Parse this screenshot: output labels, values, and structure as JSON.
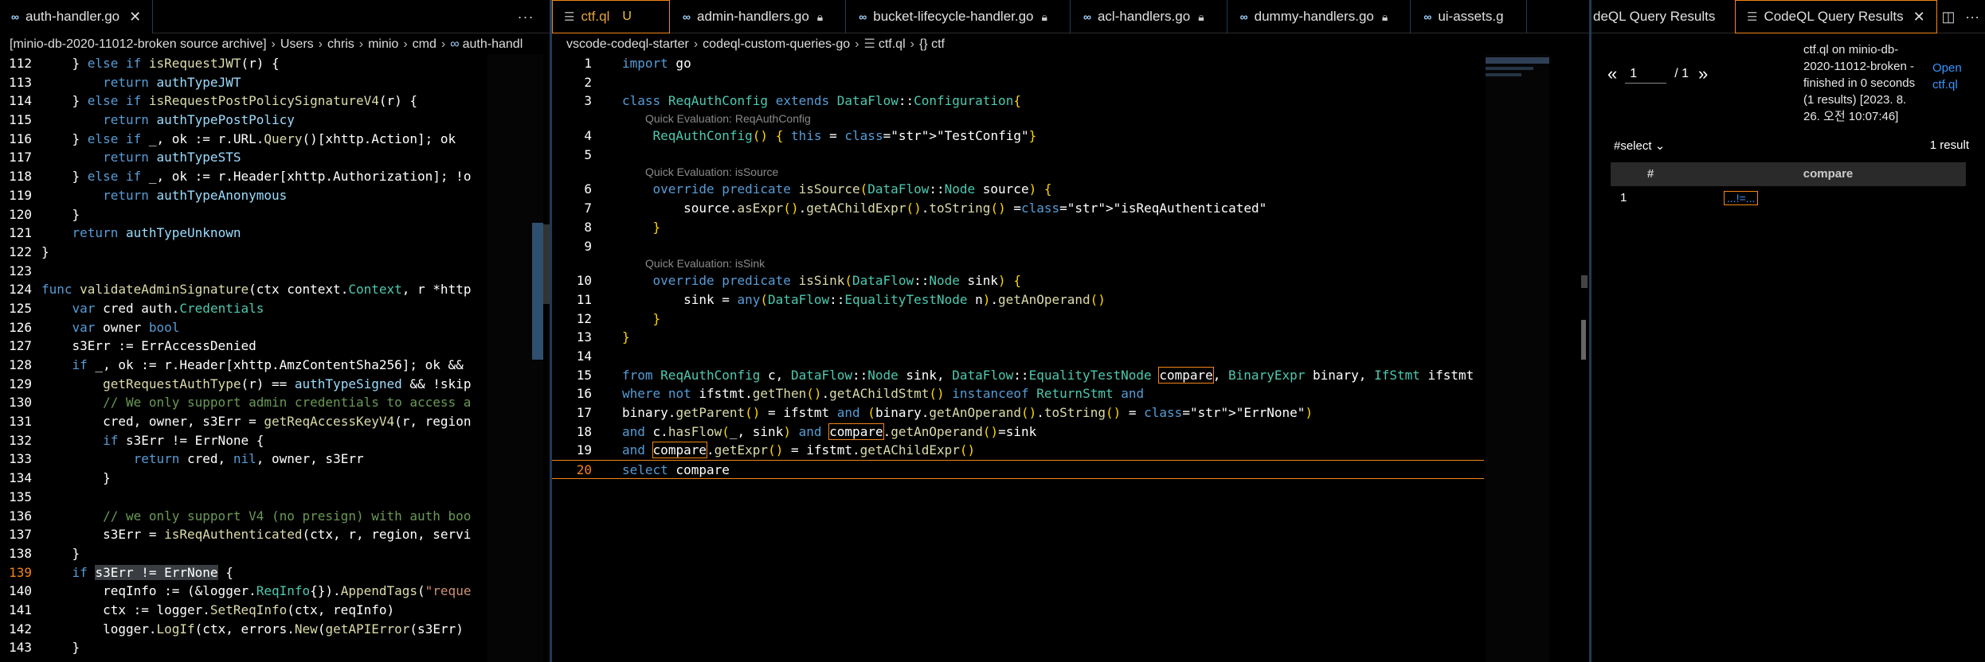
{
  "left_pane": {
    "tab": {
      "label": "auth-handler.go",
      "close": "✕"
    },
    "more": "···",
    "breadcrumb": [
      "[minio-db-2020-11012-broken source archive]",
      "Users",
      "chris",
      "minio",
      "cmd",
      "auth-handl"
    ],
    "lines": [
      {
        "n": "112",
        "t": "    } else if isRequestJWT(r) {"
      },
      {
        "n": "113",
        "t": "        return authTypeJWT"
      },
      {
        "n": "114",
        "t": "    } else if isRequestPostPolicySignatureV4(r) {"
      },
      {
        "n": "115",
        "t": "        return authTypePostPolicy"
      },
      {
        "n": "116",
        "t": "    } else if _, ok := r.URL.Query()[xhttp.Action]; ok"
      },
      {
        "n": "117",
        "t": "        return authTypeSTS"
      },
      {
        "n": "118",
        "t": "    } else if _, ok := r.Header[xhttp.Authorization]; !o"
      },
      {
        "n": "119",
        "t": "        return authTypeAnonymous"
      },
      {
        "n": "120",
        "t": "    }"
      },
      {
        "n": "121",
        "t": "    return authTypeUnknown"
      },
      {
        "n": "122",
        "t": "}"
      },
      {
        "n": "123",
        "t": ""
      },
      {
        "n": "124",
        "t": "func validateAdminSignature(ctx context.Context, r *http"
      },
      {
        "n": "125",
        "t": "    var cred auth.Credentials"
      },
      {
        "n": "126",
        "t": "    var owner bool"
      },
      {
        "n": "127",
        "t": "    s3Err := ErrAccessDenied"
      },
      {
        "n": "128",
        "t": "    if _, ok := r.Header[xhttp.AmzContentSha256]; ok &&"
      },
      {
        "n": "129",
        "t": "        getRequestAuthType(r) == authTypeSigned && !skip"
      },
      {
        "n": "130",
        "t": "        // We only support admin credentials to access a"
      },
      {
        "n": "131",
        "t": "        cred, owner, s3Err = getReqAccessKeyV4(r, region"
      },
      {
        "n": "132",
        "t": "        if s3Err != ErrNone {"
      },
      {
        "n": "133",
        "t": "            return cred, nil, owner, s3Err"
      },
      {
        "n": "134",
        "t": "        }"
      },
      {
        "n": "135",
        "t": ""
      },
      {
        "n": "136",
        "t": "        // we only support V4 (no presign) with auth boo"
      },
      {
        "n": "137",
        "t": "        s3Err = isReqAuthenticated(ctx, r, region, servi"
      },
      {
        "n": "138",
        "t": "    }"
      },
      {
        "n": "139",
        "t": "    if s3Err != ErrNone {"
      },
      {
        "n": "140",
        "t": "        reqInfo := (&logger.ReqInfo{}).AppendTags(\"reque"
      },
      {
        "n": "141",
        "t": "        ctx := logger.SetReqInfo(ctx, reqInfo)"
      },
      {
        "n": "142",
        "t": "        logger.LogIf(ctx, errors.New(getAPIError(s3Err)"
      },
      {
        "n": "143",
        "t": "    }"
      }
    ],
    "current_line": "139"
  },
  "mid_pane": {
    "tabs": [
      {
        "label": "ctf.ql",
        "badge": "U",
        "active": true
      },
      {
        "label": "admin-handlers.go"
      },
      {
        "label": "bucket-lifecycle-handler.go"
      },
      {
        "label": "acl-handlers.go"
      },
      {
        "label": "dummy-handlers.go"
      },
      {
        "label": "ui-assets.g"
      }
    ],
    "breadcrumb": [
      "vscode-codeql-starter",
      "codeql-custom-queries-go",
      "ctf.ql",
      "{} ctf"
    ],
    "codelens": {
      "config": "Quick Evaluation: ReqAuthConfig",
      "source": "Quick Evaluation: isSource",
      "sink": "Quick Evaluation: isSink"
    },
    "lines": [
      {
        "n": "1",
        "t": "import go"
      },
      {
        "n": "2",
        "t": ""
      },
      {
        "n": "3",
        "t": "class ReqAuthConfig extends DataFlow::Configuration{"
      },
      {
        "n": "4",
        "t": "    ReqAuthConfig() { this = \"TestConfig\"}"
      },
      {
        "n": "5",
        "t": ""
      },
      {
        "n": "6",
        "t": "    override predicate isSource(DataFlow::Node source) {"
      },
      {
        "n": "7",
        "t": "        source.asExpr().getAChildExpr().toString() =\"isReqAuthenticated\""
      },
      {
        "n": "8",
        "t": "    }"
      },
      {
        "n": "9",
        "t": ""
      },
      {
        "n": "10",
        "t": "    override predicate isSink(DataFlow::Node sink) {"
      },
      {
        "n": "11",
        "t": "        sink = any(DataFlow::EqualityTestNode n).getAnOperand()"
      },
      {
        "n": "12",
        "t": "    }"
      },
      {
        "n": "13",
        "t": "}"
      },
      {
        "n": "14",
        "t": ""
      },
      {
        "n": "15",
        "t": "from ReqAuthConfig c, DataFlow::Node sink, DataFlow::EqualityTestNode compare, BinaryExpr binary, IfStmt ifstmt"
      },
      {
        "n": "16",
        "t": "where not ifstmt.getThen().getAChildStmt() instanceof ReturnStmt and"
      },
      {
        "n": "17",
        "t": "binary.getParent() = ifstmt and (binary.getAnOperand().toString() = \"ErrNone\")"
      },
      {
        "n": "18",
        "t": "and c.hasFlow(_, sink) and compare.getAnOperand()=sink"
      },
      {
        "n": "19",
        "t": "and compare.getExpr() = ifstmt.getAChildExpr()"
      },
      {
        "n": "20",
        "t": "select compare"
      }
    ],
    "current_line": "20"
  },
  "right_pane": {
    "tabs": [
      {
        "label": "deQL Query Results"
      },
      {
        "label": "CodeQL Query Results",
        "active": true,
        "close": "✕"
      }
    ],
    "split_icon": "split-editor-icon",
    "more": "···",
    "pager": {
      "prev": "«",
      "page": "1",
      "total": "/ 1",
      "next": "»"
    },
    "status": "ctf.ql on minio-db-2020-11012-broken - finished in 0 seconds (1 results) [2023. 8. 26. 오전 10:07:46]",
    "open_label": "Open ctf.ql",
    "select_label": "#select",
    "result_count": "1 result",
    "table": {
      "headers": [
        "#",
        "compare"
      ],
      "rows": [
        {
          "index": "1",
          "compare": "...!=..."
        }
      ]
    }
  }
}
